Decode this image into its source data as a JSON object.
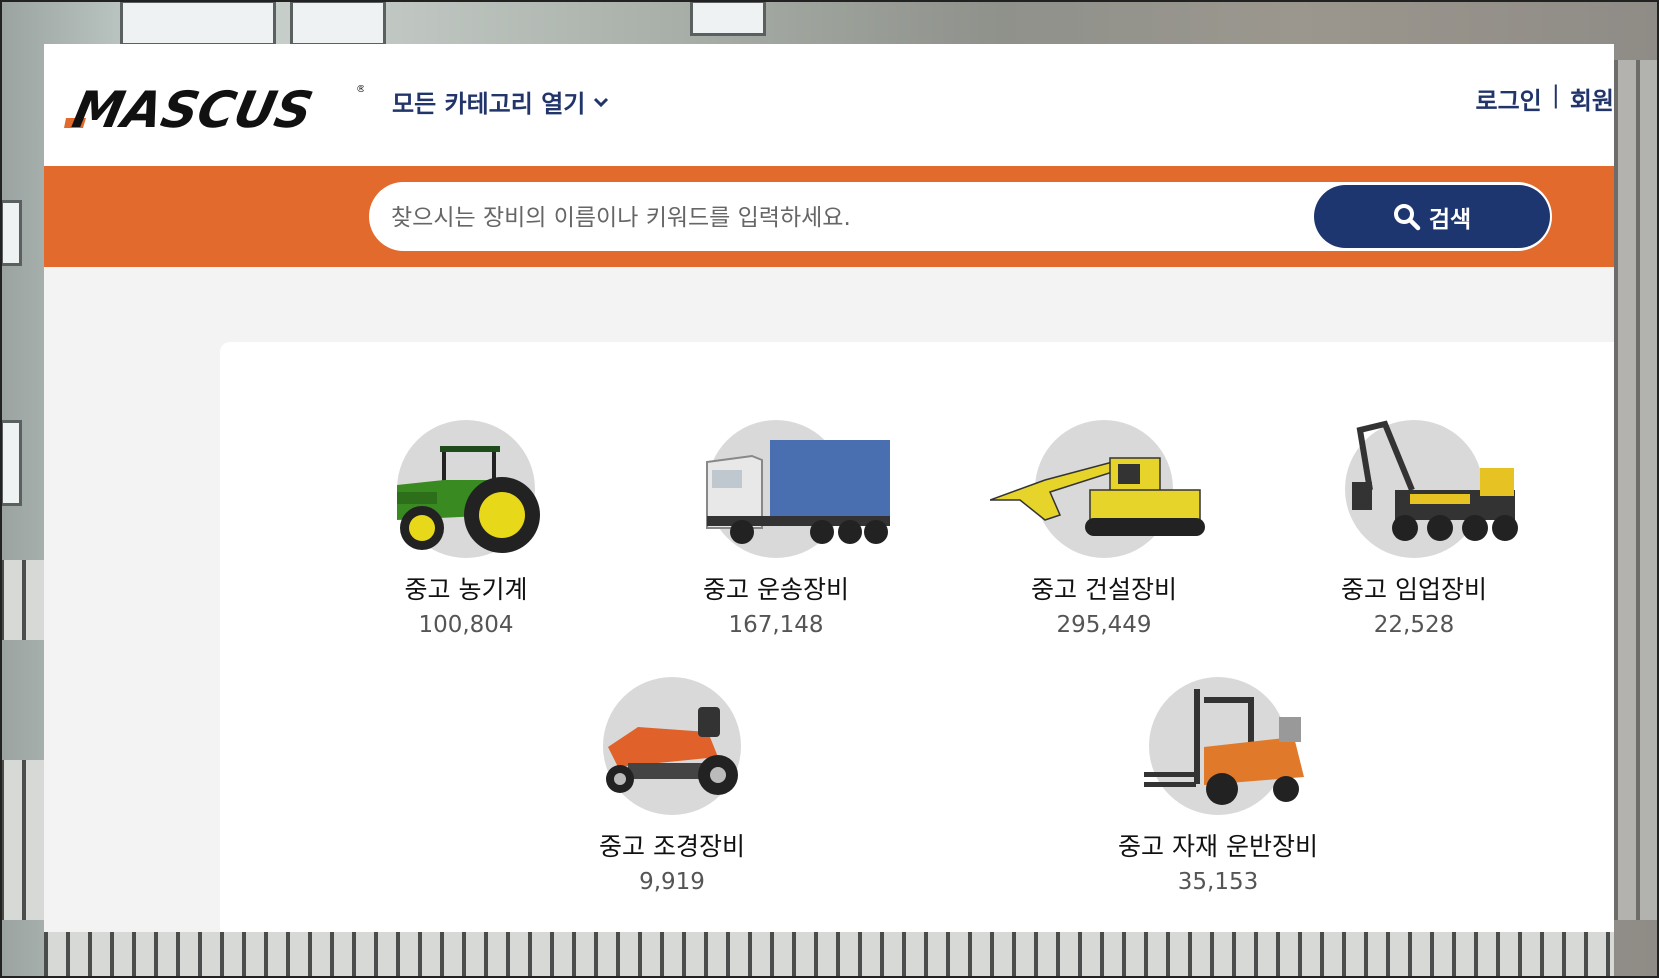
{
  "brand": {
    "logo_text": "MASCUS",
    "accent": "#e16a2c",
    "navy": "#22356b"
  },
  "header": {
    "categories_label": "모든 카테고리 열기",
    "login_label": "로그인",
    "separator": "|",
    "member_label": "회원"
  },
  "search": {
    "placeholder": "찾으시는 장비의 이름이나 키워드를 입력하세요.",
    "button_label": "검색",
    "button_icon": "search-icon"
  },
  "categories": [
    {
      "name": "중고 농기계",
      "count": "100,804",
      "icon": "tractor-icon"
    },
    {
      "name": "중고 운송장비",
      "count": "167,148",
      "icon": "truck-icon"
    },
    {
      "name": "중고 건설장비",
      "count": "295,449",
      "icon": "excavator-icon"
    },
    {
      "name": "중고 임업장비",
      "count": "22,528",
      "icon": "forestry-harvester-icon"
    },
    {
      "name": "중고 조경장비",
      "count": "9,919",
      "icon": "lawn-mower-icon"
    },
    {
      "name": "중고 자재 운반장비",
      "count": "35,153",
      "icon": "forklift-icon"
    }
  ]
}
